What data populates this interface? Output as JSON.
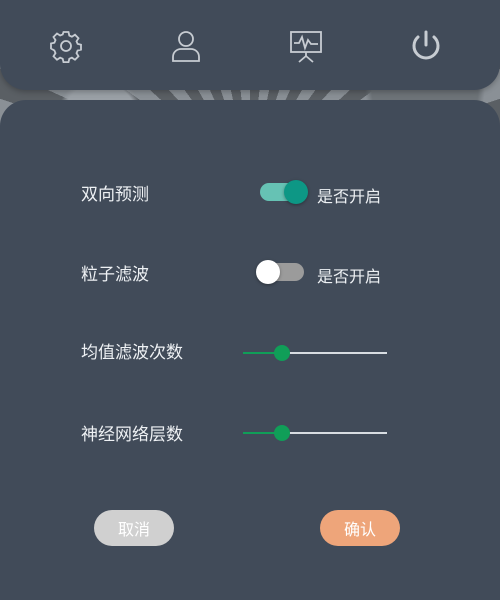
{
  "toolbar": {
    "icons": [
      "gear-icon",
      "user-icon",
      "monitor-chart-icon",
      "power-icon"
    ],
    "icon_color": "#c7ccd2"
  },
  "settings": {
    "bidirectional": {
      "label": "双向预测",
      "toggle_text": "是否开启",
      "enabled": true
    },
    "particle_filter": {
      "label": "粒子滤波",
      "toggle_text": "是否开启",
      "enabled": false
    },
    "mean_filter_count": {
      "label": "均值滤波次数",
      "value_fraction": 0.27
    },
    "nn_layers": {
      "label": "神经网络层数",
      "value_fraction": 0.27
    }
  },
  "actions": {
    "cancel_label": "取消",
    "confirm_label": "确认"
  },
  "colors": {
    "panel": "#414b59",
    "toggle_on_track": "#66c2b4",
    "toggle_on_knob": "#0d9785",
    "slider_accent": "#109e58",
    "cancel_button": "#d0d0d0",
    "confirm_button": "#eea57a"
  }
}
